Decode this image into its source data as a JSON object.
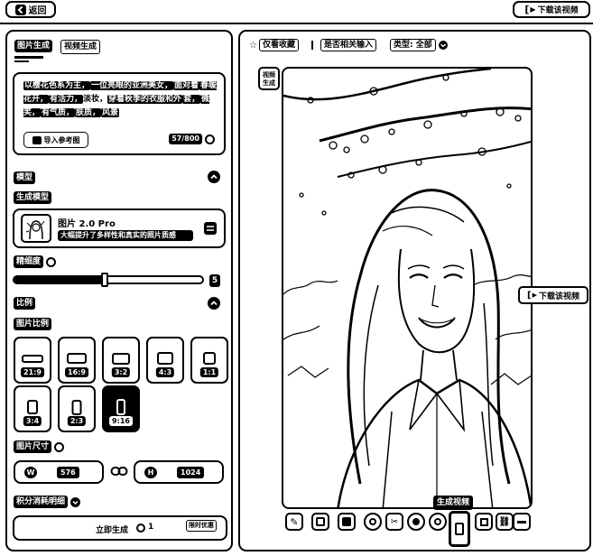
{
  "topbar": {
    "back_label": "返回",
    "download_label": "下载该视频"
  },
  "left": {
    "tabs": [
      {
        "label": "图片生成"
      },
      {
        "label": "视频生成"
      }
    ],
    "prompt": {
      "segments": [
        {
          "text": "以樱花色系为主，",
          "hl": true
        },
        {
          "text": "一位亮眼的亚洲美女，",
          "hl": true
        },
        {
          "text": "面对着",
          "hl": true
        },
        {
          "text": "春暖花开，",
          "hl": true
        },
        {
          "text": "有活力，",
          "hl": true
        },
        {
          "text": "淡妆，",
          "hl": false
        },
        {
          "text": "穿着秋季的衣服和外",
          "hl": true
        },
        {
          "text": "套，",
          "hl": true
        },
        {
          "text": "微笑，",
          "hl": true
        },
        {
          "text": "有气质，",
          "hl": true
        },
        {
          "text": "肤质，",
          "hl": true
        },
        {
          "text": "风景",
          "hl": true
        }
      ],
      "import_ref_label": "导入参考图",
      "char_count": "57/800"
    },
    "model_section_label": "模型",
    "model_type_label": "生成模型",
    "model": {
      "name": "图片 2.0 Pro",
      "desc": "大幅提升了多样性和真实的照片质感"
    },
    "precision": {
      "label": "精细度",
      "value": "5",
      "fraction": 0.48
    },
    "ratio_section_label": "比例",
    "ratio_sub_label": "图片比例",
    "ratios": [
      {
        "label": "21:9",
        "selected": false
      },
      {
        "label": "16:9",
        "selected": false
      },
      {
        "label": "3:2",
        "selected": false
      },
      {
        "label": "4:3",
        "selected": false
      },
      {
        "label": "1:1",
        "selected": false
      },
      {
        "label": "3:4",
        "selected": false
      },
      {
        "label": "2:3",
        "selected": false
      },
      {
        "label": "9:16",
        "selected": true
      }
    ],
    "size_label": "图片尺寸",
    "width": {
      "letter": "W",
      "value": "576"
    },
    "height": {
      "letter": "H",
      "value": "1024"
    },
    "detail_label": "积分消耗明细",
    "generate": {
      "label": "立即生成",
      "cost": "1",
      "limited_label": "限时优惠"
    }
  },
  "right": {
    "toolbar": {
      "favorites_label": "仅看收藏",
      "compose_label": "是否相关输入",
      "type_label": "类型: 全部"
    },
    "thumb_label": "视频生成",
    "side_download_label": "下载该视频",
    "tooltip": "生成视频"
  }
}
